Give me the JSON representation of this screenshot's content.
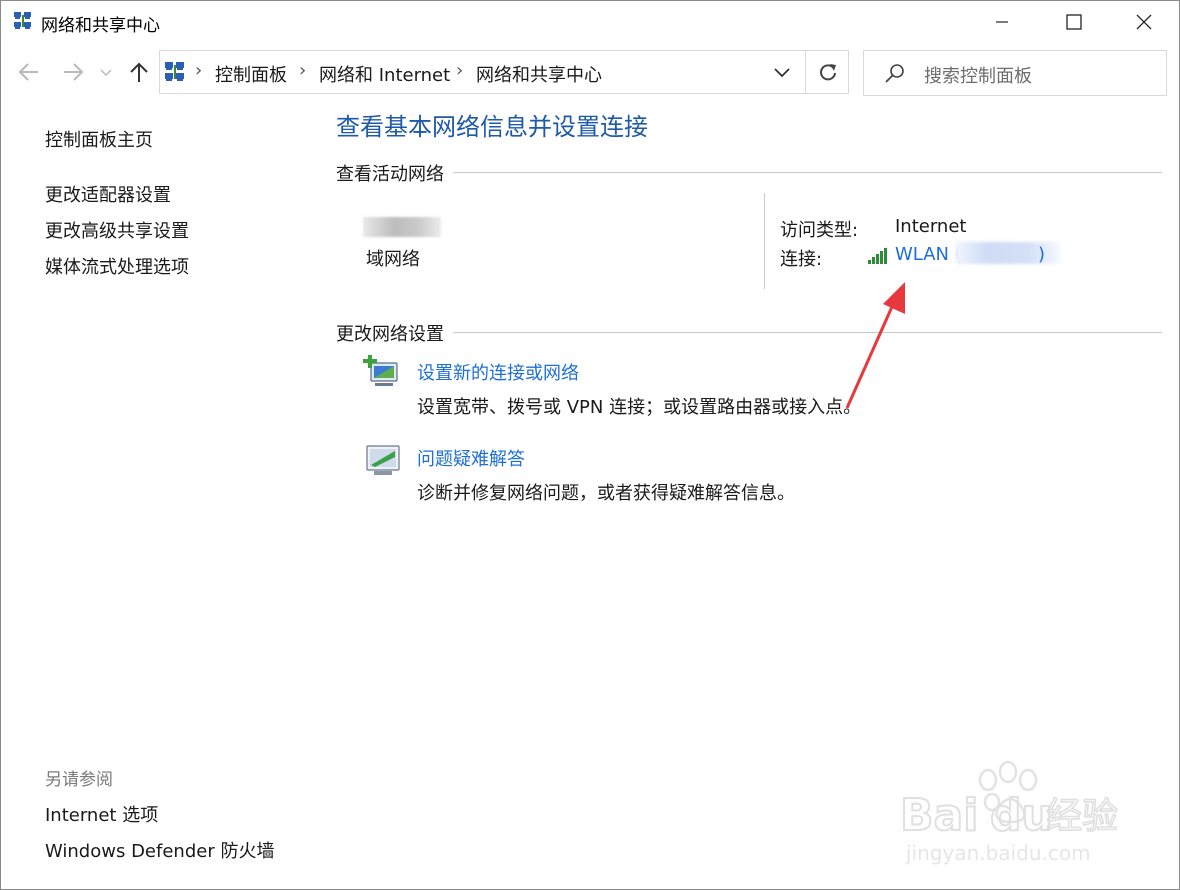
{
  "window": {
    "title": "网络和共享中心"
  },
  "nav": {
    "back_icon": "arrow-left-icon",
    "forward_icon": "arrow-right-icon",
    "up_icon": "arrow-up-icon"
  },
  "address_bar": {
    "crumbs": [
      "控制面板",
      "网络和 Internet",
      "网络和共享中心"
    ],
    "separator": "›"
  },
  "search": {
    "placeholder": "搜索控制面板"
  },
  "left_pane": {
    "home": "控制面板主页",
    "links": [
      "更改适配器设置",
      "更改高级共享设置",
      "媒体流式处理选项"
    ],
    "see_also_title": "另请参阅",
    "see_also": [
      "Internet 选项",
      "Windows Defender 防火墙"
    ]
  },
  "main": {
    "title": "查看基本网络信息并设置连接",
    "active_networks_header": "查看活动网络",
    "network": {
      "type": "域网络",
      "access_type_label": "访问类型:",
      "access_type_value": "Internet",
      "connection_label": "连接:",
      "connection_value": "WLAN ("
    },
    "change_settings_header": "更改网络设置",
    "tasks": [
      {
        "title": "设置新的连接或网络",
        "desc": "设置宽带、拨号或 VPN 连接；或设置路由器或接入点。"
      },
      {
        "title": "问题疑难解答",
        "desc": "诊断并修复网络问题，或者获得疑难解答信息。"
      }
    ]
  },
  "colors": {
    "link": "#1e6fd8",
    "title": "#1e5aa8",
    "annotation_arrow": "#e8383d"
  }
}
